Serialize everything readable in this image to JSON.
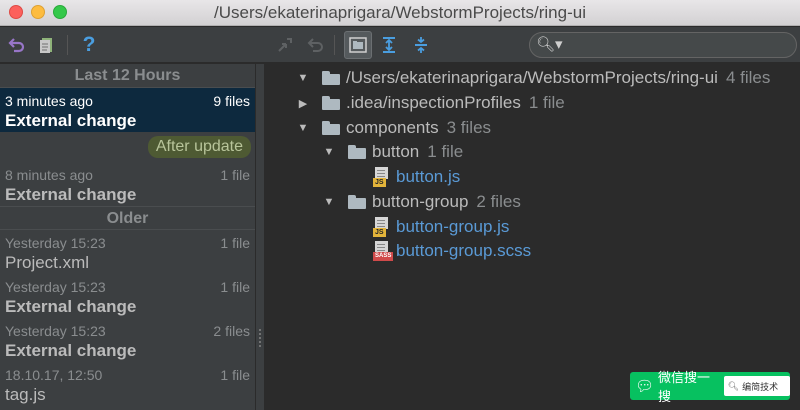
{
  "window": {
    "title": "/Users/ekaterinaprigara/WebstormProjects/ring-ui"
  },
  "toolbar": {
    "revert_icon": "undo-arrow-icon",
    "file_icon": "document-icon",
    "help_label": "?",
    "expand_icon": "expand-all-icon",
    "collapse_icon": "collapse-all-icon",
    "search_placeholder": ""
  },
  "history": {
    "groups": [
      {
        "label": "Last 12 Hours"
      },
      {
        "label": "Older"
      }
    ],
    "entries": [
      {
        "time": "3 minutes ago",
        "files": "9 files",
        "title": "External change",
        "bold": true,
        "selected": true
      },
      {
        "time": "8 minutes ago",
        "files": "1 file",
        "title": "External change",
        "bold": true
      },
      {
        "time": "Yesterday 15:23",
        "files": "1 file",
        "title": "Project.xml",
        "bold": false
      },
      {
        "time": "Yesterday 15:23",
        "files": "1 file",
        "title": "External change",
        "bold": true
      },
      {
        "time": "Yesterday 15:23",
        "files": "2 files",
        "title": "External change",
        "bold": true
      },
      {
        "time": "18.10.17, 12:50",
        "files": "1 file",
        "title": "tag.js",
        "bold": false
      }
    ],
    "after_update_label": "After update"
  },
  "tree": {
    "root": {
      "name": "/Users/ekaterinaprigara/WebstormProjects/ring-ui",
      "count": "4 files"
    },
    "idea": {
      "name": ".idea/inspectionProfiles",
      "count": "1 file"
    },
    "components": {
      "name": "components",
      "count": "3 files"
    },
    "button": {
      "name": "button",
      "count": "1 file"
    },
    "button_js": {
      "name": "button.js",
      "tag": "JS"
    },
    "button_group": {
      "name": "button-group",
      "count": "2 files"
    },
    "button_group_js": {
      "name": "button-group.js",
      "tag": "JS"
    },
    "button_group_scss": {
      "name": "button-group.scss",
      "tag": "SASS"
    }
  },
  "watermark": {
    "text": "微信搜一搜",
    "box_text": "编简技术"
  },
  "colors": {
    "selection": "#0d293e",
    "file_link": "#5a9ad6",
    "after_update_bg": "#4e5a33",
    "watermark": "#07c160"
  }
}
